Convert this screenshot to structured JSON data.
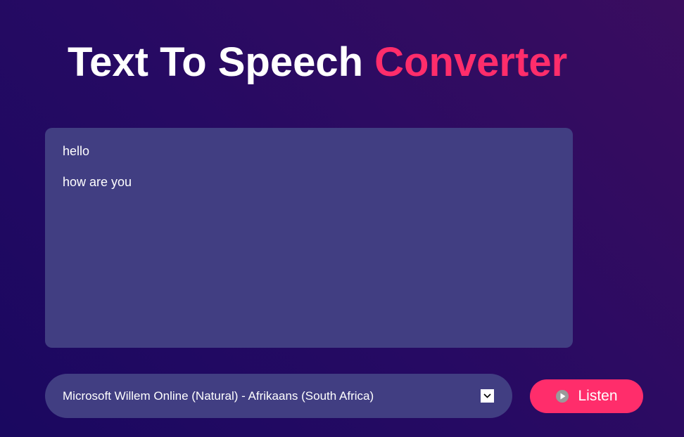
{
  "header": {
    "title_main": "Text To Speech",
    "title_accent": "Converter"
  },
  "editor": {
    "lines": [
      "hello",
      "how are you"
    ]
  },
  "voice": {
    "selected": "Microsoft Willem Online (Natural) - Afrikaans (South Africa)"
  },
  "listen_button": {
    "label": "Listen",
    "icon": "play-icon"
  },
  "colors": {
    "accent": "#ff2d6b",
    "panel": "#413e82",
    "background_start": "#1a0860",
    "background_end": "#3a0d5f"
  }
}
